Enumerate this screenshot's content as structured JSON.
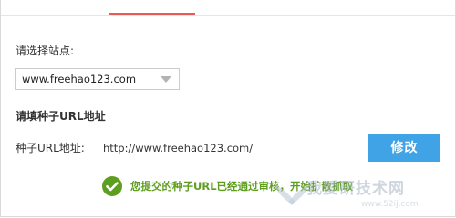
{
  "tab": {
    "indicator_color": "#e8595a"
  },
  "site": {
    "label": "请选择站点:",
    "selected_value": "www.freehao123.com"
  },
  "seed": {
    "section_title": "请填种子URL地址",
    "url_label": "种子URL地址:",
    "url_value": "http://www.freehao123.com/",
    "modify_button_label": "修改",
    "button_color": "#3fa3e5"
  },
  "status": {
    "message": "您提交的种子URL已经通过审核，开始扩散抓取",
    "icon": "check-circle-icon",
    "color": "#5e9e1e"
  },
  "watermark": {
    "main_text": "我爱研技术网",
    "sub_text": "www.52ij.com"
  }
}
